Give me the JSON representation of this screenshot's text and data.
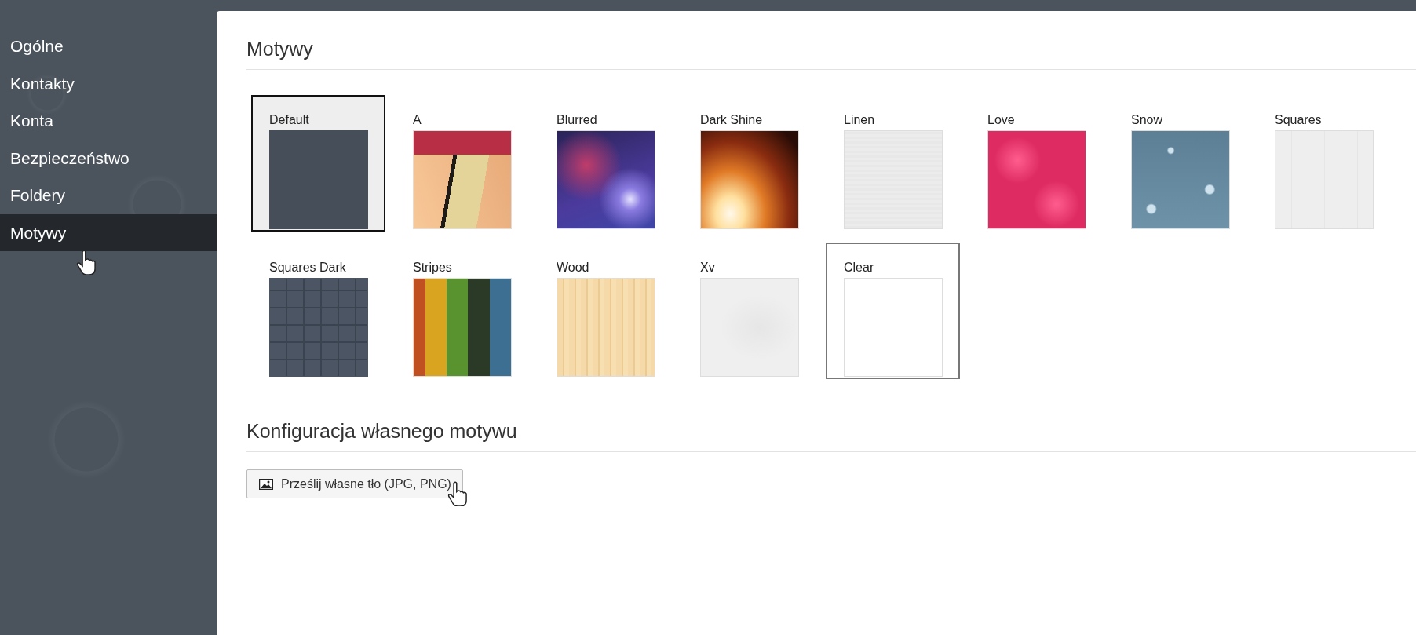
{
  "sidebar": {
    "items": [
      {
        "label": "Ogólne",
        "selected": false
      },
      {
        "label": "Kontakty",
        "selected": false
      },
      {
        "label": "Konta",
        "selected": false
      },
      {
        "label": "Bezpieczeństwo",
        "selected": false
      },
      {
        "label": "Foldery",
        "selected": false
      },
      {
        "label": "Motywy",
        "selected": true
      }
    ]
  },
  "themes": {
    "title": "Motywy",
    "items": [
      {
        "label": "Default",
        "kind": "slate",
        "selected": true,
        "hovered": false
      },
      {
        "label": "A",
        "kind": "panels",
        "selected": false,
        "hovered": false
      },
      {
        "label": "Blurred",
        "kind": "blur",
        "selected": false,
        "hovered": false
      },
      {
        "label": "Dark Shine",
        "kind": "glow",
        "selected": false,
        "hovered": false
      },
      {
        "label": "Linen",
        "kind": "linen",
        "selected": false,
        "hovered": false
      },
      {
        "label": "Love",
        "kind": "petals",
        "selected": false,
        "hovered": false
      },
      {
        "label": "Snow",
        "kind": "snowflakes",
        "selected": false,
        "hovered": false
      },
      {
        "label": "Squares",
        "kind": "tiles",
        "selected": false,
        "hovered": false
      },
      {
        "label": "Squares Dark",
        "kind": "dark-tiles",
        "selected": false,
        "hovered": false
      },
      {
        "label": "Stripes",
        "kind": "stripes",
        "selected": false,
        "hovered": false
      },
      {
        "label": "Wood",
        "kind": "wood",
        "selected": false,
        "hovered": false
      },
      {
        "label": "Xv",
        "kind": "leaves",
        "selected": false,
        "hovered": false
      },
      {
        "label": "Clear",
        "kind": "blank",
        "selected": false,
        "hovered": true
      }
    ]
  },
  "custom": {
    "title": "Konfiguracja własnego motywu",
    "upload_button": "Prześlij własne tło (JPG, PNG)"
  }
}
